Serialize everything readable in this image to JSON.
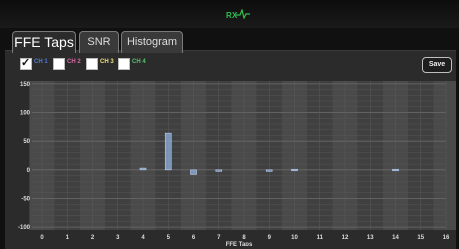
{
  "header": {
    "logo_text": "RX",
    "logo_color": "#2fbf4f"
  },
  "tabs": [
    {
      "label": "FFE Taps",
      "active": true
    },
    {
      "label": "SNR",
      "active": false
    },
    {
      "label": "Histogram",
      "active": false
    }
  ],
  "channels": [
    {
      "label": "CH 1",
      "checked": true,
      "color": "#4f7bd8"
    },
    {
      "label": "CH 2",
      "checked": false,
      "color": "#d86aa5"
    },
    {
      "label": "CH 3",
      "checked": false,
      "color": "#f0e07a"
    },
    {
      "label": "CH 4",
      "checked": false,
      "color": "#55c46a"
    }
  ],
  "toolbar": {
    "save_label": "Save"
  },
  "chart_data": {
    "type": "bar",
    "xlabel": "FFE Taps",
    "ylabel": "",
    "categories": [
      "0",
      "1",
      "2",
      "3",
      "4",
      "5",
      "6",
      "7",
      "8",
      "9",
      "10",
      "11",
      "12",
      "13",
      "14",
      "15",
      "16"
    ],
    "ylim": [
      -105,
      155
    ],
    "yticks": [
      150,
      100,
      50,
      0,
      -50,
      -100
    ],
    "series": [
      {
        "values": [
          0,
          0,
          0,
          0,
          3,
          64,
          -8,
          -2,
          0,
          -2,
          1,
          0,
          0,
          0,
          1,
          0,
          0
        ]
      }
    ],
    "bar_color": "#8fb0dd",
    "grid": true
  }
}
